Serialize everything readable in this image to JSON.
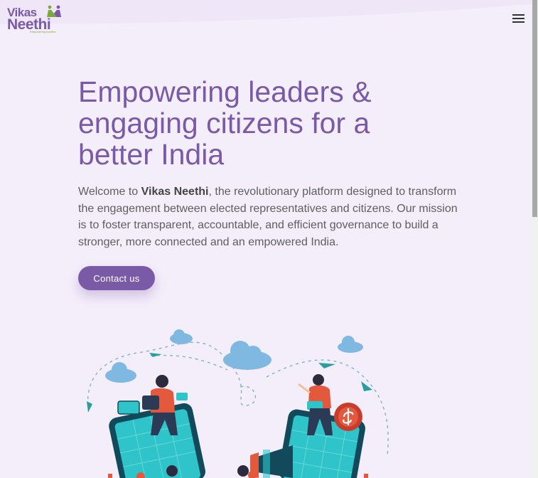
{
  "header": {
    "logo": {
      "line1": "Vikas",
      "line2": "Neethi",
      "tagline": "Empowering leaders"
    },
    "menu_icon": "hamburger-menu-icon"
  },
  "hero": {
    "title": "Empowering leaders & engaging citizens for a better India",
    "description_prefix": "Welcome to ",
    "description_brand": "Vikas Neethi",
    "description_suffix": ", the revolutionary platform designed to transform the engagement between elected representatives and citizens. Our mission is to foster transparent, accountable, and efficient governance to build a stronger, more connected and an empowered India.",
    "cta_label": "Contact us",
    "illustration_icon": "people-with-tablets-illustration-icon"
  },
  "colors": {
    "brand_purple": "#7a5aa6",
    "brand_green": "#7da83a",
    "background": "#f4eefb",
    "accent_teal": "#2ec4c9",
    "accent_cloud": "#7fb8e0"
  }
}
